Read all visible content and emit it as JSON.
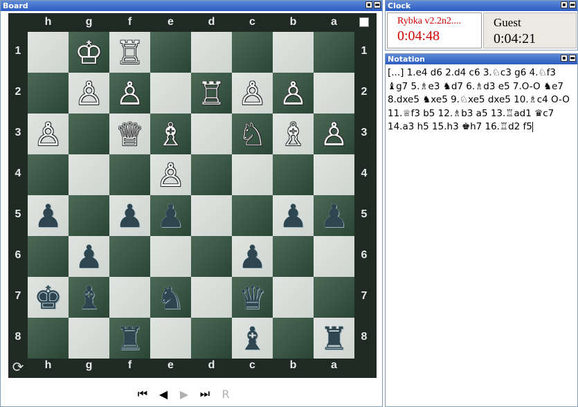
{
  "board_panel": {
    "title": "Board"
  },
  "clock_panel": {
    "title": "Clock"
  },
  "notation_panel": {
    "title": "Notation"
  },
  "titlebar_buttons": {
    "restore": "▪",
    "close": "▬"
  },
  "board": {
    "files": [
      "h",
      "g",
      "f",
      "e",
      "d",
      "c",
      "b",
      "a"
    ],
    "ranks": [
      "1",
      "2",
      "3",
      "4",
      "5",
      "6",
      "7",
      "8"
    ],
    "flip_icon": "⟳",
    "pieces": [
      {
        "sq": "g1",
        "glyph": "♔",
        "color": "white"
      },
      {
        "sq": "f1",
        "glyph": "♖",
        "color": "white"
      },
      {
        "sq": "g2",
        "glyph": "♙",
        "color": "white"
      },
      {
        "sq": "f2",
        "glyph": "♙",
        "color": "white"
      },
      {
        "sq": "d2",
        "glyph": "♖",
        "color": "white"
      },
      {
        "sq": "c2",
        "glyph": "♙",
        "color": "white"
      },
      {
        "sq": "b2",
        "glyph": "♙",
        "color": "white"
      },
      {
        "sq": "h3",
        "glyph": "♙",
        "color": "white"
      },
      {
        "sq": "f3",
        "glyph": "♕",
        "color": "white"
      },
      {
        "sq": "e3",
        "glyph": "♗",
        "color": "white"
      },
      {
        "sq": "c3",
        "glyph": "♘",
        "color": "white"
      },
      {
        "sq": "b3",
        "glyph": "♗",
        "color": "white"
      },
      {
        "sq": "a3",
        "glyph": "♙",
        "color": "white"
      },
      {
        "sq": "e4",
        "glyph": "♙",
        "color": "white"
      },
      {
        "sq": "h5",
        "glyph": "♟",
        "color": "black"
      },
      {
        "sq": "f5",
        "glyph": "♟",
        "color": "black"
      },
      {
        "sq": "e5",
        "glyph": "♟",
        "color": "black"
      },
      {
        "sq": "b5",
        "glyph": "♟",
        "color": "black"
      },
      {
        "sq": "a5",
        "glyph": "♟",
        "color": "black"
      },
      {
        "sq": "g6",
        "glyph": "♟",
        "color": "black"
      },
      {
        "sq": "c6",
        "glyph": "♟",
        "color": "black"
      },
      {
        "sq": "h7",
        "glyph": "♚",
        "color": "black"
      },
      {
        "sq": "g7",
        "glyph": "♝",
        "color": "black"
      },
      {
        "sq": "e7",
        "glyph": "♞",
        "color": "black"
      },
      {
        "sq": "c7",
        "glyph": "♛",
        "color": "black"
      },
      {
        "sq": "f8",
        "glyph": "♜",
        "color": "black"
      },
      {
        "sq": "c8",
        "glyph": "♝",
        "color": "black"
      },
      {
        "sq": "a8",
        "glyph": "♜",
        "color": "black"
      }
    ]
  },
  "nav": {
    "first": "⏮",
    "prev": "◀",
    "next": "▶",
    "last": "⏭",
    "r": "R"
  },
  "clock": {
    "white": {
      "name": "Rybka v2.2n2....",
      "time": "0:04:48"
    },
    "black": {
      "name": "Guest",
      "time": "0:04:21"
    }
  },
  "notation": {
    "text": "[...] 1.e4 d6 2.d4 c6 3.♘c3 g6 4.♘f3 ♝g7 5.♗e3 ♞d7 6.♗d3 e5 7.O-O ♞e7 8.dxe5 ♞xe5 9.♘xe5 dxe5 10.♗c4 O-O 11.♕f3 b5 12.♗b3 a5 13.♖ad1 ♛c7 14.a3 h5 15.h3 ♚h7 16.♖d2 f5"
  },
  "colors": {
    "titlebar": "#2a5cc1",
    "clock_active": "#d10000",
    "light_square": "#d7dcd8",
    "dark_square": "#3d5a48"
  }
}
